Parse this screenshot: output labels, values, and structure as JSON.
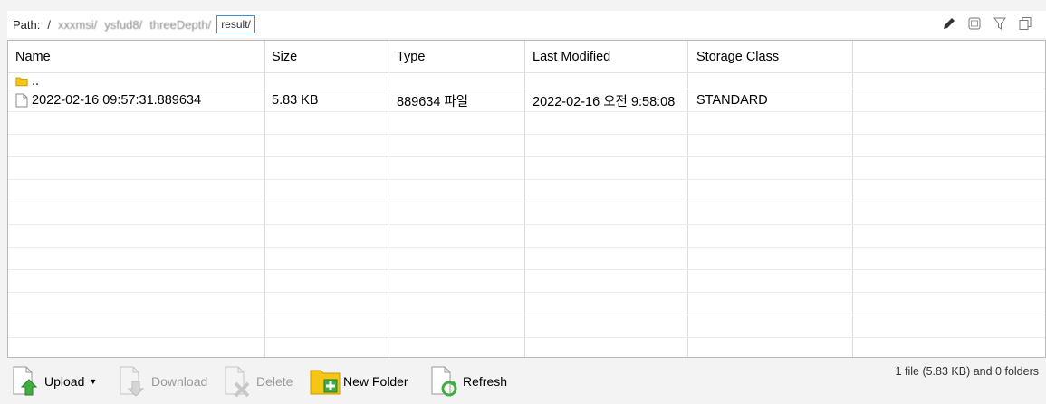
{
  "path": {
    "label": "Path:",
    "root": "/",
    "segments": [
      "xxxmsi/",
      "ysfud8/",
      "threeDepth/"
    ],
    "current": "result/"
  },
  "table": {
    "headers": [
      "Name",
      "Size",
      "Type",
      "Last Modified",
      "Storage Class"
    ],
    "parent_row": "..",
    "rows": [
      {
        "name": "2022-02-16 09:57:31.889634",
        "size": "5.83 KB",
        "type": "889634 파일",
        "modified": "2022-02-16 오전 9:58:08",
        "storage": "STANDARD"
      }
    ]
  },
  "toolbar": {
    "upload": "Upload",
    "download": "Download",
    "delete": "Delete",
    "new_folder": "New Folder",
    "refresh": "Refresh"
  },
  "status": "1 file (5.83 KB) and 0 folders",
  "icons": [
    "pencil-icon",
    "window-icon",
    "filter-icon",
    "copy-icon",
    "folder-icon",
    "file-icon",
    "upload-icon",
    "download-icon",
    "delete-icon",
    "new-folder-icon",
    "refresh-icon"
  ],
  "colors": {
    "accent": "#3d8fd6",
    "folder": "#f5c518",
    "arrow_green": "#3fae3f"
  }
}
